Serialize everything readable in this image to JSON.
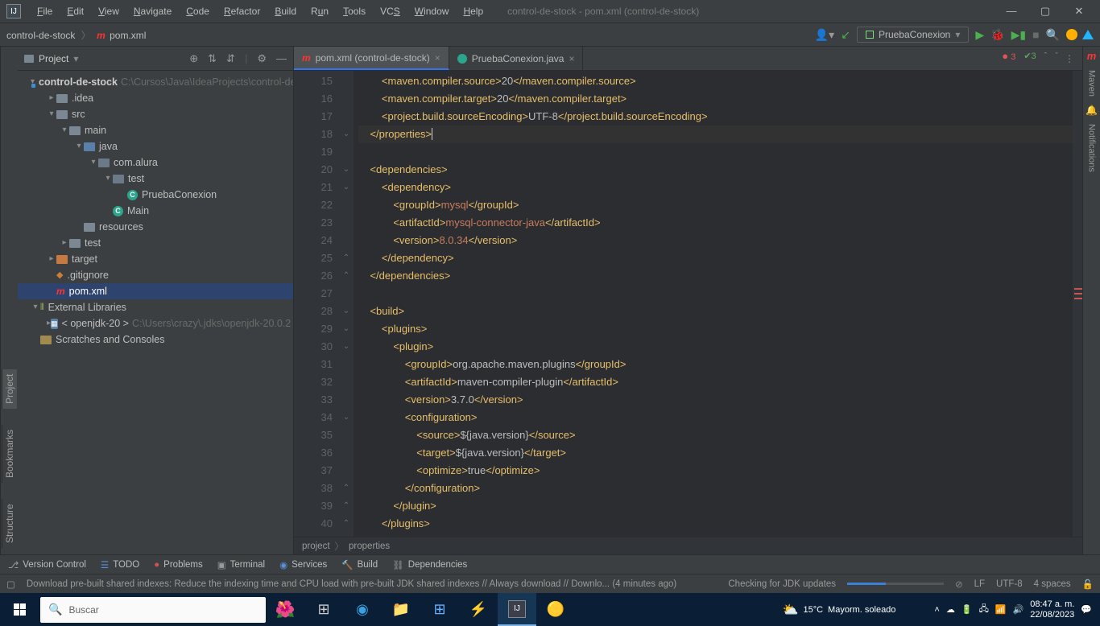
{
  "window": {
    "title": "control-de-stock - pom.xml (control-de-stock)",
    "menu": [
      "File",
      "Edit",
      "View",
      "Navigate",
      "Code",
      "Refactor",
      "Build",
      "Run",
      "Tools",
      "VCS",
      "Window",
      "Help"
    ]
  },
  "nav": {
    "crumb1": "control-de-stock",
    "crumb2": "pom.xml",
    "runconfig": "PruebaConexion"
  },
  "project": {
    "title": "Project",
    "root": "control-de-stock",
    "rootPath": "C:\\Cursos\\Java\\IdeaProjects\\control-de-stock",
    "idea": ".idea",
    "src": "src",
    "main": "main",
    "java": "java",
    "pkg": "com.alura",
    "pkg_test": "test",
    "prueba": "PruebaConexion",
    "maincls": "Main",
    "resources": "resources",
    "test": "test",
    "target": "target",
    "gitignore": ".gitignore",
    "pom": "pom.xml",
    "extlib": "External Libraries",
    "jdk": "< openjdk-20 >",
    "jdkPath": "C:\\Users\\crazy\\.jdks\\openjdk-20.0.2",
    "scratches": "Scratches and Consoles"
  },
  "tabs": {
    "t1": "pom.xml (control-de-stock)",
    "t2": "PruebaConexion.java"
  },
  "inspect": {
    "errors": "3",
    "passed": "3"
  },
  "code": {
    "lines": [
      "15",
      "16",
      "17",
      "18",
      "19",
      "20",
      "21",
      "22",
      "23",
      "24",
      "25",
      "26",
      "27",
      "28",
      "29",
      "30",
      "31",
      "32",
      "33",
      "34",
      "35",
      "36",
      "37",
      "38",
      "39",
      "40"
    ],
    "l15a": "<maven.compiler.source>",
    "l15b": "20",
    "l15c": "</maven.compiler.source>",
    "l16a": "<maven.compiler.target>",
    "l16b": "20",
    "l16c": "</maven.compiler.target>",
    "l17a": "<project.build.sourceEncoding>",
    "l17b": "UTF-8",
    "l17c": "</project.build.sourceEncoding>",
    "l18": "</properties>",
    "l20": "<dependencies>",
    "l21": "<dependency>",
    "l22a": "<groupId>",
    "l22b": "mysql",
    "l22c": "</groupId>",
    "l23a": "<artifactId>",
    "l23b": "mysql-connector-java",
    "l23c": "</artifactId>",
    "l24a": "<version>",
    "l24b": "8.0.34",
    "l24c": "</version>",
    "l25": "</dependency>",
    "l26": "</dependencies>",
    "l28": "<build>",
    "l29": "<plugins>",
    "l30": "<plugin>",
    "l31a": "<groupId>",
    "l31b": "org.apache.maven.plugins",
    "l31c": "</groupId>",
    "l32a": "<artifactId>",
    "l32b": "maven-compiler-plugin",
    "l32c": "</artifactId>",
    "l33a": "<version>",
    "l33b": "3.7.0",
    "l33c": "</version>",
    "l34": "<configuration>",
    "l35a": "<source>",
    "l35b": "${java.version}",
    "l35c": "</source>",
    "l36a": "<target>",
    "l36b": "${java.version}",
    "l36c": "</target>",
    "l37a": "<optimize>",
    "l37b": "true",
    "l37c": "</optimize>",
    "l38": "</configuration>",
    "l39": "</plugin>",
    "l40": "</plugins>"
  },
  "breadcrumb": {
    "b1": "project",
    "b2": "properties"
  },
  "bottomTabs": {
    "vc": "Version Control",
    "todo": "TODO",
    "problems": "Problems",
    "terminal": "Terminal",
    "services": "Services",
    "build": "Build",
    "deps": "Dependencies"
  },
  "status": {
    "msg": "Download pre-built shared indexes: Reduce the indexing time and CPU load with pre-built JDK shared indexes // Always download // Downlo... (4 minutes ago)",
    "task": "Checking for JDK updates",
    "lf": "LF",
    "enc": "UTF-8",
    "indent": "4 spaces"
  },
  "taskbar": {
    "search": "Buscar",
    "temp": "15°C",
    "weather": "Mayorm. soleado",
    "time": "08:47 a. m.",
    "date": "22/08/2023"
  },
  "leftTabs": {
    "project": "Project",
    "bookmarks": "Bookmarks",
    "structure": "Structure"
  },
  "rightTabs": {
    "maven": "Maven",
    "notif": "Notifications"
  }
}
